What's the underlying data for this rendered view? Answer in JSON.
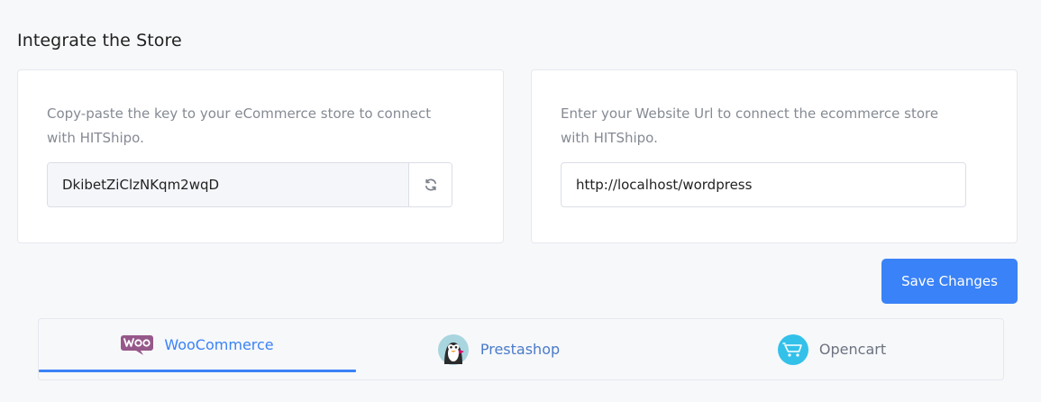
{
  "page": {
    "title": "Integrate the Store"
  },
  "key_card": {
    "description": "Copy-paste the key to your eCommerce store to connect with HITShipo.",
    "key_value": "DkibetZiClzNKqm2wqD",
    "refresh_icon": "refresh-icon"
  },
  "url_card": {
    "description": "Enter your Website Url to connect the ecommerce store with HITShipo.",
    "url_value": "http://localhost/wordpress"
  },
  "actions": {
    "save_label": "Save Changes"
  },
  "platform_tabs": [
    {
      "label": "WooCommerce",
      "icon": "woocommerce-logo",
      "active": true
    },
    {
      "label": "Prestashop",
      "icon": "prestashop-logo",
      "active": false
    },
    {
      "label": "Opencart",
      "icon": "opencart-logo",
      "active": false
    }
  ],
  "colors": {
    "accent": "#3a82f7",
    "woo_purple": "#96588a",
    "opencart_blue": "#33c1ea",
    "muted_text": "#858a93"
  }
}
